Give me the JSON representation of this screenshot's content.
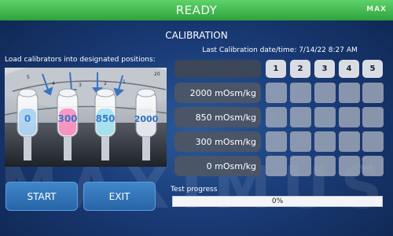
{
  "header": {
    "status": "READY",
    "brand": "MAX"
  },
  "calibration": {
    "title": "CALIBRATION",
    "last_calibration": "Last Calibration date/time:  7/14/22 8:27 AM",
    "instructions": "Load calibrators into designated positions:"
  },
  "photo": {
    "vials": [
      {
        "label": "0",
        "color": "#9ccbf0"
      },
      {
        "label": "300",
        "color": "#ff78b4"
      },
      {
        "label": "850",
        "color": "#8fdff2"
      },
      {
        "label": "2000",
        "color": "#e2e6ec"
      }
    ],
    "position_marks": [
      "5",
      "4",
      "3",
      "2",
      "1",
      "20"
    ]
  },
  "grid": {
    "columns": [
      "1",
      "2",
      "3",
      "4",
      "5"
    ],
    "rows": [
      "2000 mOsm/kg",
      "850 mOsm/kg",
      "300 mOsm/kg",
      "0 mOsm/kg"
    ]
  },
  "buttons": {
    "start": "START",
    "exit": "EXIT"
  },
  "progress": {
    "label": "Test progress",
    "value": 0,
    "text": "0%"
  },
  "watermark": "MAXIMUS",
  "colors": {
    "background": "#1a3c78",
    "status_bar": "#2ea23c",
    "button": "#3377bb",
    "grid_cell": "#a8b0be",
    "row_label": "#4a5568",
    "progress_fill": "#4cae57"
  }
}
